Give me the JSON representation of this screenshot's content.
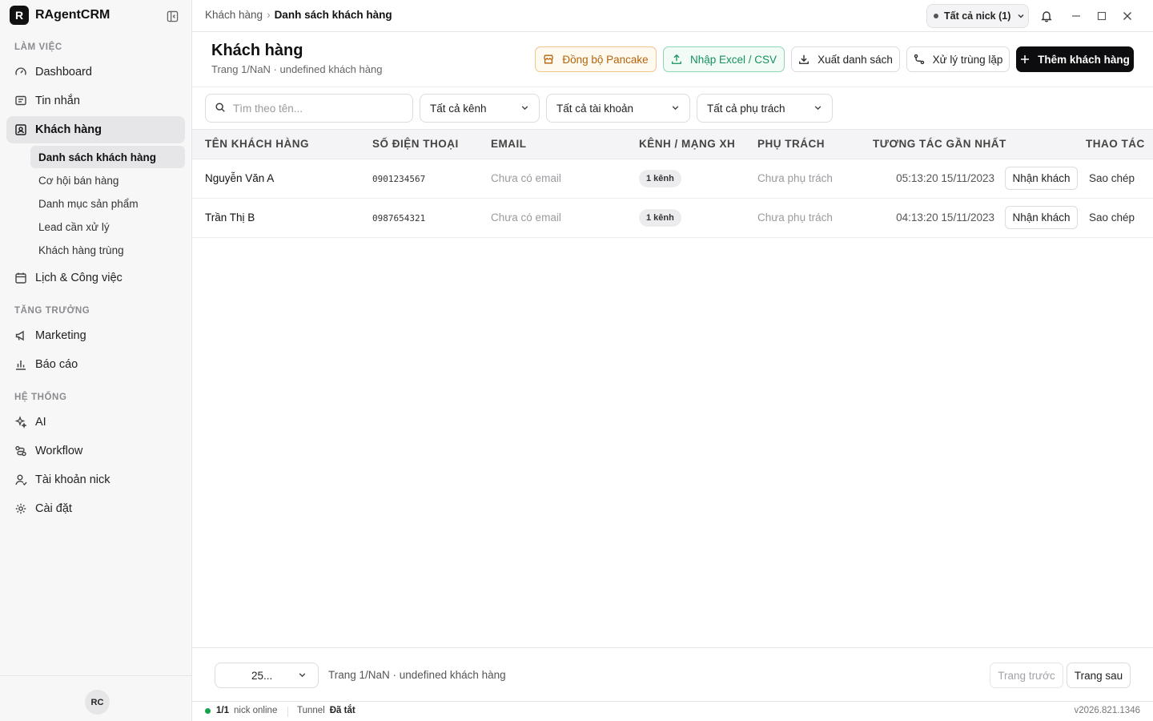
{
  "app": {
    "logo_letter": "R",
    "name": "RAgentCRM",
    "avatar": "RC"
  },
  "sidebar": {
    "sections": {
      "work": "LÀM VIỆC",
      "growth": "TĂNG TRƯỞNG",
      "system": "HỆ THỐNG"
    },
    "items": {
      "dashboard": "Dashboard",
      "messages": "Tin nhắn",
      "customers": "Khách hàng",
      "calendar": "Lịch & Công việc",
      "marketing": "Marketing",
      "reports": "Báo cáo",
      "ai": "AI",
      "workflow": "Workflow",
      "accounts": "Tài khoản nick",
      "settings": "Cài đặt"
    },
    "sub_items": {
      "list": "Danh sách khách hàng",
      "opportunities": "Cơ hội bán hàng",
      "products": "Danh mục sản phẩm",
      "leads": "Lead cần xử lý",
      "duplicates": "Khách hàng trùng"
    }
  },
  "topbar": {
    "breadcrumb_parent": "Khách hàng",
    "breadcrumb_sep": "›",
    "breadcrumb_current": "Danh sách khách hàng",
    "nick_select": "Tất cả nick (1)"
  },
  "page": {
    "title": "Khách hàng",
    "subtitle": "Trang 1/NaN · undefined khách hàng"
  },
  "actions": {
    "pancake": "Đồng bộ Pancake",
    "import": "Nhập Excel / CSV",
    "export": "Xuất danh sách",
    "dedupe": "Xử lý trùng lặp",
    "add": "Thêm khách hàng"
  },
  "filters": {
    "search_placeholder": "Tìm theo tên...",
    "channel": "Tất cả kênh",
    "account": "Tất cả tài khoản",
    "owner": "Tất cả phụ trách"
  },
  "table": {
    "headers": {
      "name": "TÊN KHÁCH HÀNG",
      "phone": "SỐ ĐIỆN THOẠI",
      "email": "EMAIL",
      "channel": "KÊNH / MẠNG XH",
      "owner": "PHỤ TRÁCH",
      "last": "TƯƠNG TÁC GẦN NHẤT",
      "actions": "THAO TÁC"
    },
    "rows": [
      {
        "name": "Nguyễn Văn A",
        "phone": "0901234567",
        "email": "Chưa có email",
        "channel": "1 kênh",
        "owner": "Chưa phụ trách",
        "last": "05:13:20 15/11/2023",
        "claim": "Nhận khách",
        "copy": "Sao chép"
      },
      {
        "name": "Trần Thị B",
        "phone": "0987654321",
        "email": "Chưa có email",
        "channel": "1 kênh",
        "owner": "Chưa phụ trách",
        "last": "04:13:20 15/11/2023",
        "claim": "Nhận khách",
        "copy": "Sao chép"
      }
    ]
  },
  "pager": {
    "page_size": "25...",
    "info": "Trang 1/NaN · undefined khách hàng",
    "prev": "Trang trước",
    "next": "Trang sau"
  },
  "status": {
    "online_count": "1/1",
    "online_label": "nick online",
    "tunnel_label": "Tunnel",
    "tunnel_value": "Đã tắt",
    "version": "v2026.821.1346"
  },
  "colors": {
    "accent": "#0d0d0f",
    "pancake": "#b4630a",
    "excel": "#15915c",
    "online": "#18a34a"
  }
}
